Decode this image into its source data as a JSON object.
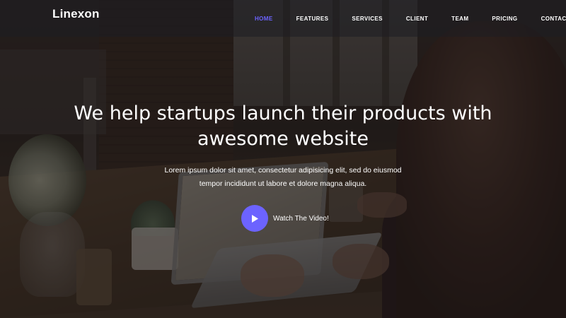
{
  "brand": {
    "name": "Linexon"
  },
  "nav": {
    "items": [
      {
        "label": "HOME",
        "active": true
      },
      {
        "label": "FEATURES",
        "active": false
      },
      {
        "label": "SERVICES",
        "active": false
      },
      {
        "label": "CLIENT",
        "active": false
      },
      {
        "label": "TEAM",
        "active": false
      },
      {
        "label": "PRICING",
        "active": false
      },
      {
        "label": "CONTACT",
        "active": false
      }
    ]
  },
  "hero": {
    "headline_line1": "We help startups launch their products with",
    "headline_line2": "awesome website",
    "lead_line1": "Lorem ipsum dolor sit amet, consectetur adipisicing elit, sed do eiusmod",
    "lead_line2": "tempor incididunt ut labore et dolore magna aliqua.",
    "cta_label": "Watch The Video!",
    "cta_icon": "play-icon"
  },
  "colors": {
    "accent": "#6c63ff",
    "text": "#ffffff",
    "navbar_bg": "rgba(30,30,34,0.55)"
  }
}
